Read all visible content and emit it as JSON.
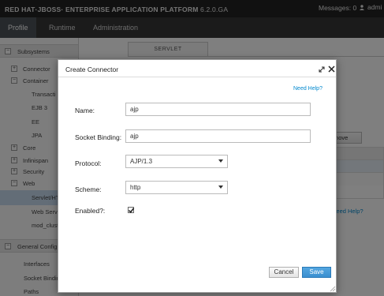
{
  "header": {
    "brand": "RED HAT·JBOSS· ENTERPRISE APPLICATION PLATFORM",
    "version": "6.2.0.GA",
    "messages": "Messages: 0",
    "user": "admi"
  },
  "nav": {
    "profile": "Profile",
    "runtime": "Runtime",
    "administration": "Administration"
  },
  "sidebar": {
    "subsystems": "Subsystems",
    "connector": "Connector",
    "container": "Container",
    "transactions": "Transacti",
    "ejb3": "EJB 3",
    "ee": "EE",
    "jpa": "JPA",
    "core": "Core",
    "infinispan": "Infinispan",
    "security": "Security",
    "web": "Web",
    "servlet": "Servlet/HT",
    "webservices": "Web Servi",
    "modcluster": "mod_clust",
    "general": "General Configu",
    "interfaces": "Interfaces",
    "socket_binding": "Socket Bindin",
    "paths": "Paths"
  },
  "background": {
    "tab_servlet": "SERVLET",
    "remove_button": "move",
    "help_link": "Need Help?"
  },
  "dialog": {
    "title": "Create Connector",
    "help": "Need Help?",
    "name_label": "Name:",
    "name_value": "ajp",
    "socket_label": "Socket Binding:",
    "socket_value": "ajp",
    "protocol_label": "Protocol:",
    "protocol_value": "AJP/1.3",
    "scheme_label": "Scheme:",
    "scheme_value": "http",
    "enabled_label": "Enabled?:",
    "enabled_checked": true,
    "cancel": "Cancel",
    "save": "Save"
  },
  "colors": {
    "accent": "#3b8fd0",
    "link": "#0088ce",
    "topbar": "#222222",
    "navbar": "#363636"
  },
  "icons": [
    "expand-icon",
    "close-icon",
    "user-icon",
    "checkbox-check-icon",
    "resize-grip-icon",
    "tree-toggle-icon"
  ]
}
